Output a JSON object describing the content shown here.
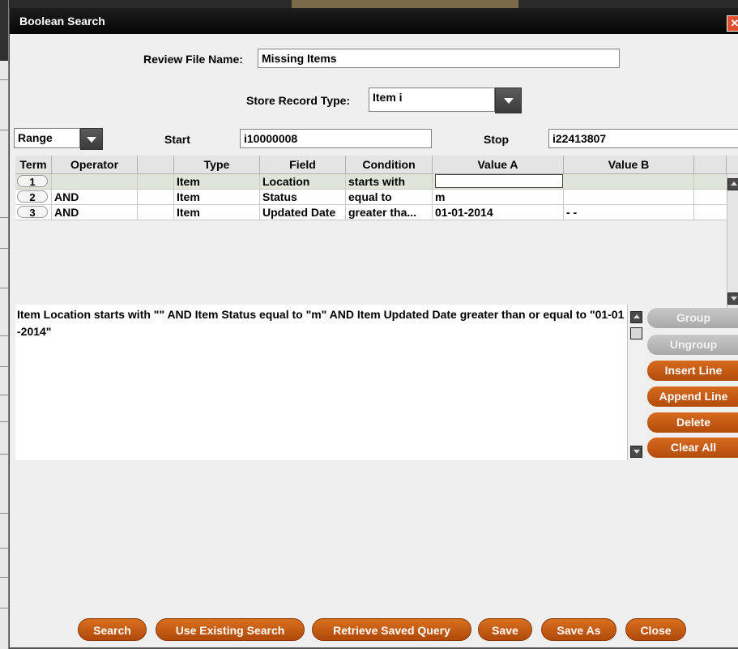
{
  "window": {
    "title": "Boolean Search",
    "close_symbol": "✕"
  },
  "review_file": {
    "label": "Review File Name:",
    "value": "Missing Items"
  },
  "store_record": {
    "label": "Store Record Type:",
    "value": "Item  i"
  },
  "range": {
    "mode": "Range",
    "start_label": "Start",
    "start_value": "i10000008",
    "stop_label": "Stop",
    "stop_value": "i22413807"
  },
  "grid": {
    "headers": [
      "Term",
      "Operator",
      "",
      "Type",
      "Field",
      "Condition",
      "Value A",
      "Value B"
    ],
    "rows": [
      {
        "term": "1",
        "operator": "",
        "type": "Item",
        "field": "Location",
        "condition": "starts with",
        "value_a": "",
        "value_b": ""
      },
      {
        "term": "2",
        "operator": "AND",
        "type": "Item",
        "field": "Status",
        "condition": "equal to",
        "value_a": "m",
        "value_b": ""
      },
      {
        "term": "3",
        "operator": "AND",
        "type": "Item",
        "field": "Updated Date",
        "condition": "greater tha...",
        "value_a": "01-01-2014",
        "value_b": "- -"
      }
    ]
  },
  "query": {
    "text": "Item  Location  starts with  \"\"    AND Item  Status  equal to  \"m\"    AND Item  Updated Date  greater than or equal to  \"01-01-2014\""
  },
  "side_buttons": {
    "group": "Group",
    "ungroup": "Ungroup",
    "insert_line": "Insert Line",
    "append_line": "Append Line",
    "delete": "Delete",
    "clear_all": "Clear All"
  },
  "bottom_buttons": {
    "search": "Search",
    "use_existing": "Use Existing Search",
    "retrieve": "Retrieve Saved Query",
    "save": "Save",
    "save_as": "Save As",
    "close": "Close"
  },
  "colors": {
    "accent": "#c55a12",
    "disabled": "#b8b8b8",
    "titlebar": "#111111"
  },
  "icons": {
    "close": "close-icon",
    "dropdown": "chevron-down-icon",
    "scroll_up": "scroll-up-icon",
    "scroll_down": "scroll-down-icon"
  }
}
